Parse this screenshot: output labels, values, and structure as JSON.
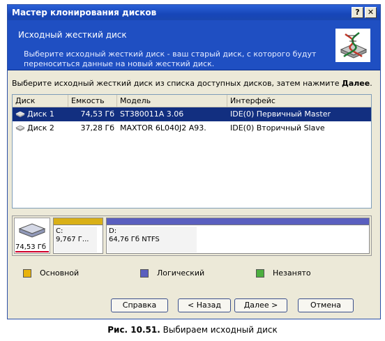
{
  "window": {
    "title": "Мастер клонирования дисков",
    "help_label": "?",
    "close_label": "✕"
  },
  "header": {
    "title": "Исходный жесткий диск",
    "description": "Выберите исходный жесткий диск - ваш старый диск, с которого будут переноситься данные на новый жесткий диск."
  },
  "instruction": {
    "text": "Выберите исходный жесткий диск из списка доступных дисков, затем нажмите ",
    "bold": "Далее",
    "end": "."
  },
  "disk_list": {
    "columns": [
      "Диск",
      "Емкость",
      "Модель",
      "Интерфейс"
    ],
    "rows": [
      {
        "disk": "Диск 1",
        "capacity": "74,53 Гб",
        "model": "ST380011A 3.06",
        "interface": "IDE(0) Первичный Master",
        "selected": true
      },
      {
        "disk": "Диск 2",
        "capacity": "37,28 Гб",
        "model": "MAXTOR 6L040J2 A93.",
        "interface": "IDE(0) Вторичный Slave",
        "selected": false
      }
    ]
  },
  "partition_map": {
    "disk_capacity": "74,53 Гб",
    "partitions": [
      {
        "name": "C:",
        "detail": "9,767 Г...",
        "type": "primary"
      },
      {
        "name": "D:",
        "detail": "64,76 Гб  NTFS",
        "type": "logical"
      }
    ]
  },
  "legend": {
    "primary": "Основной",
    "logical": "Логический",
    "free": "Незанято"
  },
  "colors": {
    "primary": "#e8b30c",
    "logical": "#5a5fbf",
    "free": "#4caf3f",
    "selection": "#122f80",
    "header": "#1f4fc2"
  },
  "buttons": {
    "help": "Справка",
    "back": "< Назад",
    "next": "Далее >",
    "cancel": "Отмена"
  },
  "caption": {
    "bold": "Рис. 10.51.",
    "text": " Выбираем исходный диск"
  }
}
